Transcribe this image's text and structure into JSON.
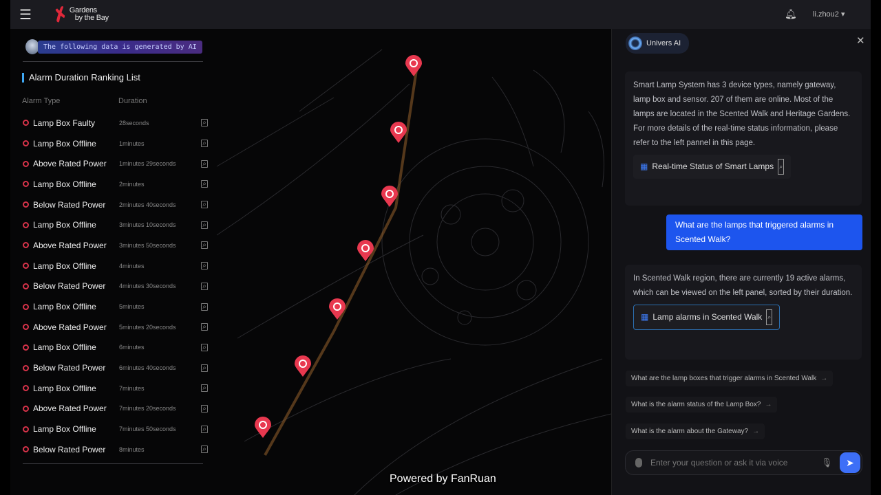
{
  "header": {
    "brand_line1": "Gardens",
    "brand_line2": "by the Bay",
    "user": "li.zhou2 ▾"
  },
  "ai_banner": "The following data is generated by AI",
  "ranking": {
    "title": "Alarm Duration Ranking List",
    "columns": [
      "Alarm Type",
      "Duration"
    ],
    "rows": [
      {
        "type": "Lamp Box Faulty",
        "duration": "28seconds"
      },
      {
        "type": "Lamp Box Offline",
        "duration": "1minutes"
      },
      {
        "type": "Above Rated Power",
        "duration": "1minutes 29seconds"
      },
      {
        "type": "Lamp Box Offline",
        "duration": "2minutes"
      },
      {
        "type": "Below Rated Power",
        "duration": "2minutes 40seconds"
      },
      {
        "type": "Lamp Box Offline",
        "duration": "3minutes 10seconds"
      },
      {
        "type": "Above Rated Power",
        "duration": "3minutes 50seconds"
      },
      {
        "type": "Lamp Box Offline",
        "duration": "4minutes"
      },
      {
        "type": "Below Rated Power",
        "duration": "4minutes 30seconds"
      },
      {
        "type": "Lamp Box Offline",
        "duration": "5minutes"
      },
      {
        "type": "Above Rated Power",
        "duration": "5minutes 20seconds"
      },
      {
        "type": "Lamp Box Offline",
        "duration": "6minutes"
      },
      {
        "type": "Below Rated Power",
        "duration": "6minutes 40seconds"
      },
      {
        "type": "Lamp Box Offline",
        "duration": "7minutes"
      },
      {
        "type": "Above Rated Power",
        "duration": "7minutes 20seconds"
      },
      {
        "type": "Lamp Box Offline",
        "duration": "7minutes 50seconds"
      },
      {
        "type": "Below Rated Power",
        "duration": "8minutes"
      }
    ]
  },
  "watermark": "Powered by FanRuan",
  "chat": {
    "title": "Univers AI",
    "msg1": "Smart Lamp System has 3 device types, namely gateway, lamp box and sensor. 207 of them are online. Most of the lamps are located in the Scented Walk and Heritage Gardens. For more details of the real-time status information, please refer to the left pannel in this page.",
    "card1": "Real-time Status of Smart Lamps",
    "user_msg": "What are the lamps that triggered alarms in Scented Walk?",
    "msg2": "In Scented Walk region, there are currently 19 active alarms, which can be viewed on the left panel, sorted by their duration.",
    "card2": "Lamp alarms in Scented Walk",
    "suggestions": [
      "What are the lamp boxes that trigger alarms in Scented Walk",
      "What is the alarm status of the Lamp Box?",
      "What is the alarm about the Gateway?"
    ],
    "input_placeholder": "Enter your question or ask it via voice"
  },
  "colors": {
    "accent": "#3d6ff7",
    "alarm": "#e8384f",
    "title_bar": "#3fa9f5"
  }
}
